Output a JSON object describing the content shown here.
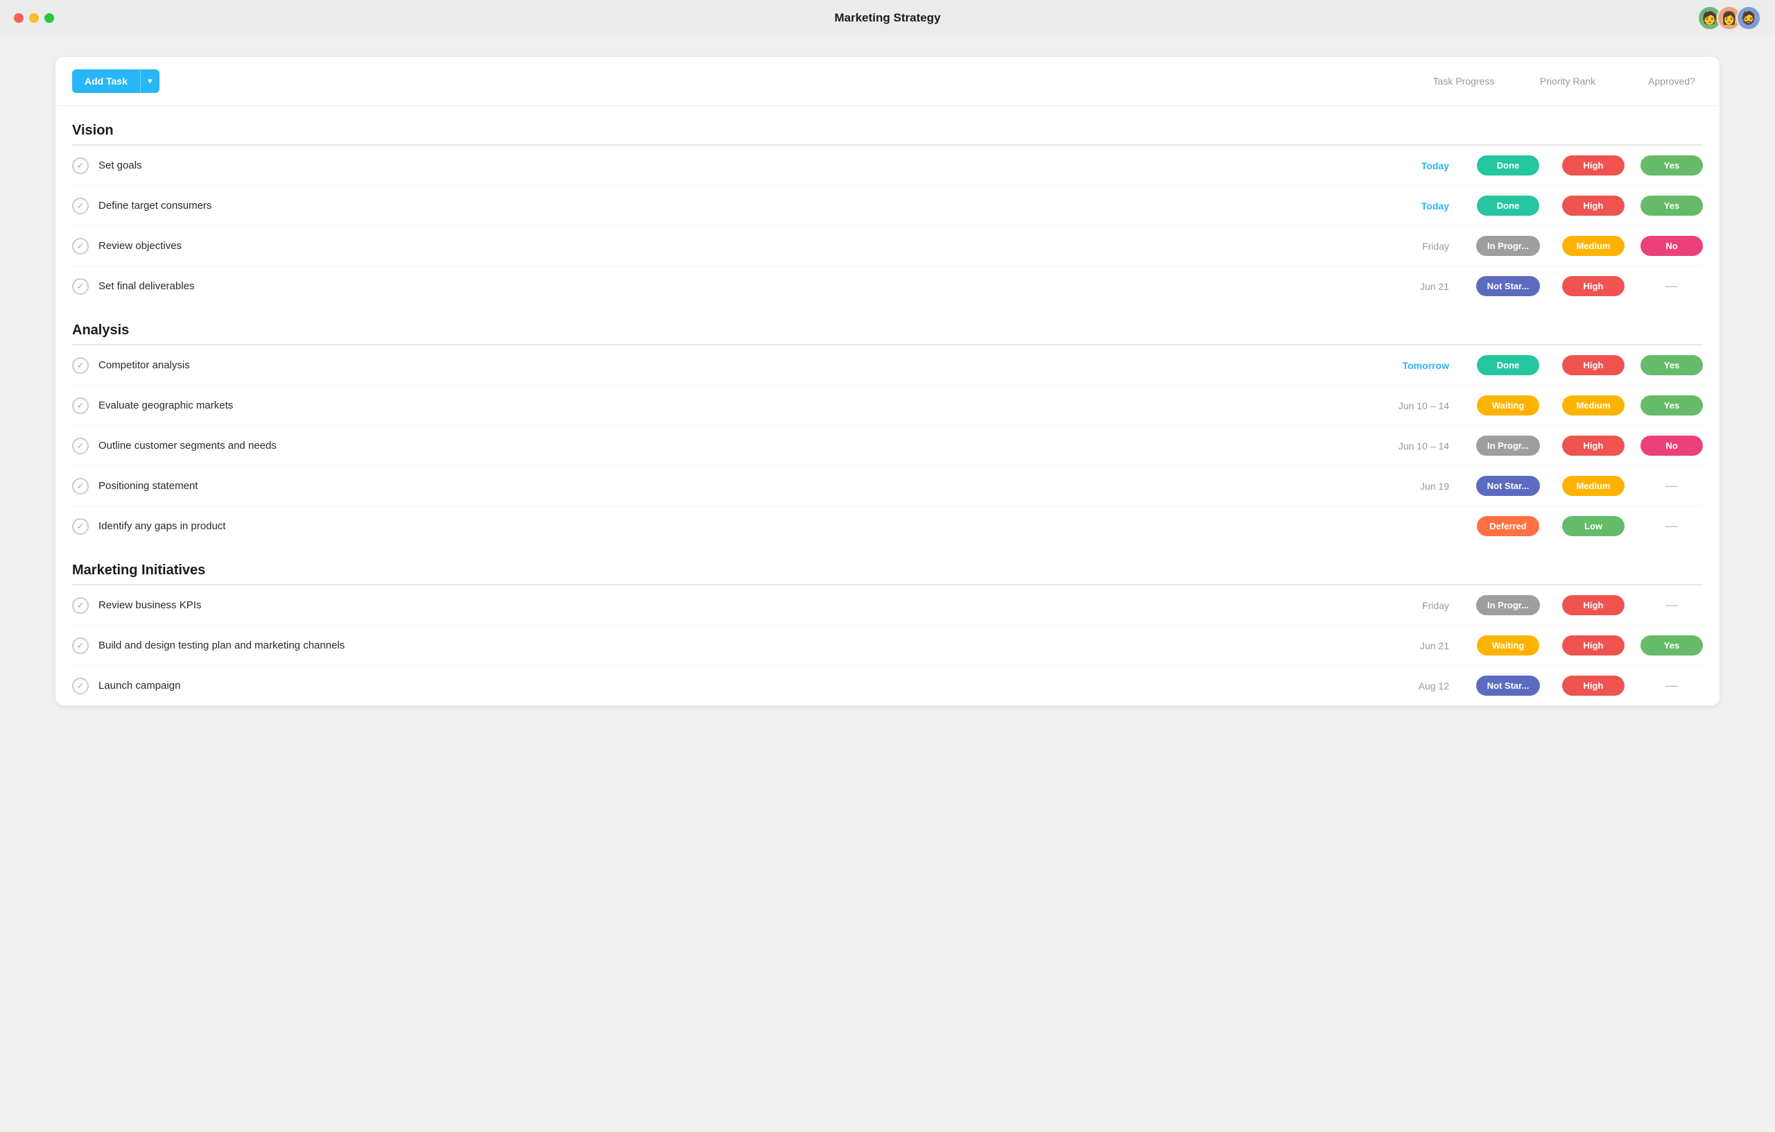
{
  "titleBar": {
    "title": "Marketing Strategy",
    "trafficLights": [
      "red",
      "yellow",
      "green"
    ]
  },
  "toolbar": {
    "addTaskLabel": "Add Task",
    "dropdownIcon": "▾",
    "columns": [
      "Task Progress",
      "Priority Rank",
      "Approved?"
    ]
  },
  "sections": [
    {
      "name": "Vision",
      "tasks": [
        {
          "name": "Set goals",
          "date": "Today",
          "dateStyle": "today",
          "status": "Done",
          "statusStyle": "done",
          "priority": "High",
          "priorityStyle": "high",
          "approved": "Yes",
          "approvedStyle": "yes"
        },
        {
          "name": "Define target consumers",
          "date": "Today",
          "dateStyle": "today",
          "status": "Done",
          "statusStyle": "done",
          "priority": "High",
          "priorityStyle": "high",
          "approved": "Yes",
          "approvedStyle": "yes"
        },
        {
          "name": "Review objectives",
          "date": "Friday",
          "dateStyle": "normal",
          "status": "In Progr...",
          "statusStyle": "in-progress",
          "priority": "Medium",
          "priorityStyle": "medium",
          "approved": "No",
          "approvedStyle": "no"
        },
        {
          "name": "Set final deliverables",
          "date": "Jun 21",
          "dateStyle": "normal",
          "status": "Not Star...",
          "statusStyle": "not-started",
          "priority": "High",
          "priorityStyle": "high",
          "approved": "—",
          "approvedStyle": "dash"
        }
      ]
    },
    {
      "name": "Analysis",
      "tasks": [
        {
          "name": "Competitor analysis",
          "date": "Tomorrow",
          "dateStyle": "tomorrow",
          "status": "Done",
          "statusStyle": "done",
          "priority": "High",
          "priorityStyle": "high",
          "approved": "Yes",
          "approvedStyle": "yes"
        },
        {
          "name": "Evaluate geographic markets",
          "date": "Jun 10 – 14",
          "dateStyle": "normal",
          "status": "Waiting",
          "statusStyle": "waiting",
          "priority": "Medium",
          "priorityStyle": "medium",
          "approved": "Yes",
          "approvedStyle": "yes"
        },
        {
          "name": "Outline customer segments and needs",
          "date": "Jun 10 – 14",
          "dateStyle": "normal",
          "status": "In Progr...",
          "statusStyle": "in-progress",
          "priority": "High",
          "priorityStyle": "high",
          "approved": "No",
          "approvedStyle": "no"
        },
        {
          "name": "Positioning statement",
          "date": "Jun 19",
          "dateStyle": "normal",
          "status": "Not Star...",
          "statusStyle": "not-started",
          "priority": "Medium",
          "priorityStyle": "medium",
          "approved": "—",
          "approvedStyle": "dash"
        },
        {
          "name": "Identify any gaps in product",
          "date": "",
          "dateStyle": "normal",
          "status": "Deferred",
          "statusStyle": "deferred",
          "priority": "Low",
          "priorityStyle": "low",
          "approved": "—",
          "approvedStyle": "dash"
        }
      ]
    },
    {
      "name": "Marketing Initiatives",
      "tasks": [
        {
          "name": "Review business KPIs",
          "date": "Friday",
          "dateStyle": "normal",
          "status": "In Progr...",
          "statusStyle": "in-progress",
          "priority": "High",
          "priorityStyle": "high",
          "approved": "—",
          "approvedStyle": "dash"
        },
        {
          "name": "Build and design testing plan and marketing channels",
          "date": "Jun 21",
          "dateStyle": "normal",
          "status": "Waiting",
          "statusStyle": "waiting",
          "priority": "High",
          "priorityStyle": "high",
          "approved": "Yes",
          "approvedStyle": "yes"
        },
        {
          "name": "Launch campaign",
          "date": "Aug 12",
          "dateStyle": "normal",
          "status": "Not Star...",
          "statusStyle": "not-started",
          "priority": "High",
          "priorityStyle": "high",
          "approved": "—",
          "approvedStyle": "dash"
        }
      ]
    }
  ]
}
